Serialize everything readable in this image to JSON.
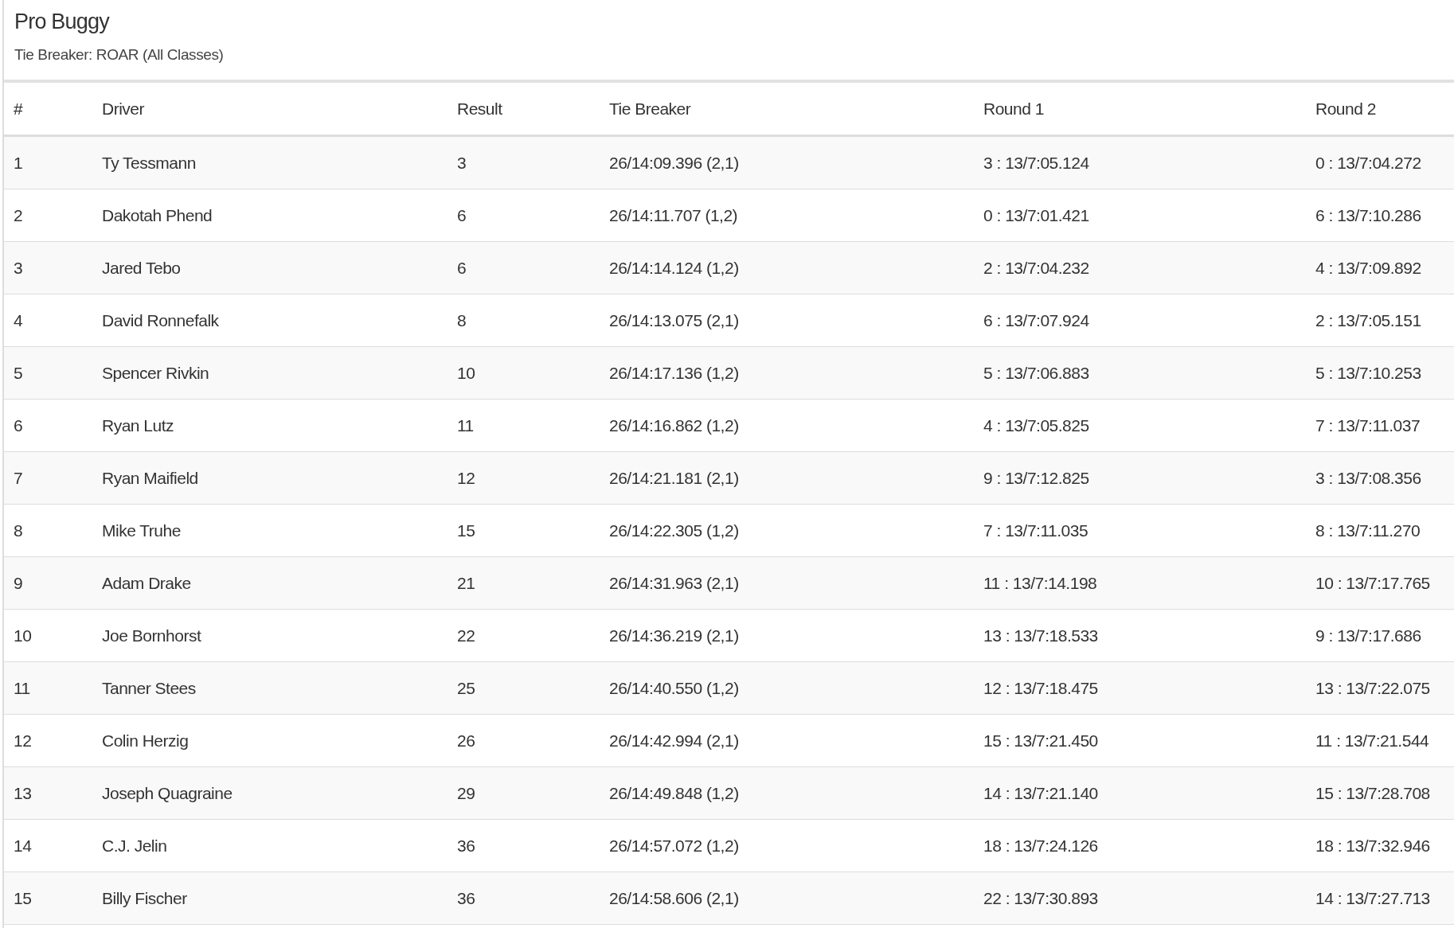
{
  "title": "Pro Buggy",
  "subtitle": "Tie Breaker: ROAR (All Classes)",
  "table": {
    "columns": [
      "#",
      "Driver",
      "Result",
      "Tie Breaker",
      "Round 1",
      "Round 2"
    ],
    "rows": [
      [
        "1",
        "Ty Tessmann",
        "3",
        "26/14:09.396 (2,1)",
        "3 : 13/7:05.124",
        "0 : 13/7:04.272"
      ],
      [
        "2",
        "Dakotah Phend",
        "6",
        "26/14:11.707 (1,2)",
        "0 : 13/7:01.421",
        "6 : 13/7:10.286"
      ],
      [
        "3",
        "Jared Tebo",
        "6",
        "26/14:14.124 (1,2)",
        "2 : 13/7:04.232",
        "4 : 13/7:09.892"
      ],
      [
        "4",
        "David Ronnefalk",
        "8",
        "26/14:13.075 (2,1)",
        "6 : 13/7:07.924",
        "2 : 13/7:05.151"
      ],
      [
        "5",
        "Spencer Rivkin",
        "10",
        "26/14:17.136 (1,2)",
        "5 : 13/7:06.883",
        "5 : 13/7:10.253"
      ],
      [
        "6",
        "Ryan Lutz",
        "11",
        "26/14:16.862 (1,2)",
        "4 : 13/7:05.825",
        "7 : 13/7:11.037"
      ],
      [
        "7",
        "Ryan Maifield",
        "12",
        "26/14:21.181 (2,1)",
        "9 : 13/7:12.825",
        "3 : 13/7:08.356"
      ],
      [
        "8",
        "Mike Truhe",
        "15",
        "26/14:22.305 (1,2)",
        "7 : 13/7:11.035",
        "8 : 13/7:11.270"
      ],
      [
        "9",
        "Adam Drake",
        "21",
        "26/14:31.963 (2,1)",
        "11 : 13/7:14.198",
        "10 : 13/7:17.765"
      ],
      [
        "10",
        "Joe Bornhorst",
        "22",
        "26/14:36.219 (2,1)",
        "13 : 13/7:18.533",
        "9 : 13/7:17.686"
      ],
      [
        "11",
        "Tanner Stees",
        "25",
        "26/14:40.550 (1,2)",
        "12 : 13/7:18.475",
        "13 : 13/7:22.075"
      ],
      [
        "12",
        "Colin Herzig",
        "26",
        "26/14:42.994 (2,1)",
        "15 : 13/7:21.450",
        "11 : 13/7:21.544"
      ],
      [
        "13",
        "Joseph Quagraine",
        "29",
        "26/14:49.848 (1,2)",
        "14 : 13/7:21.140",
        "15 : 13/7:28.708"
      ],
      [
        "14",
        "C.J. Jelin",
        "36",
        "26/14:57.072 (1,2)",
        "18 : 13/7:24.126",
        "18 : 13/7:32.946"
      ],
      [
        "15",
        "Billy Fischer",
        "36",
        "26/14:58.606 (2,1)",
        "22 : 13/7:30.893",
        "14 : 13/7:27.713"
      ]
    ]
  }
}
